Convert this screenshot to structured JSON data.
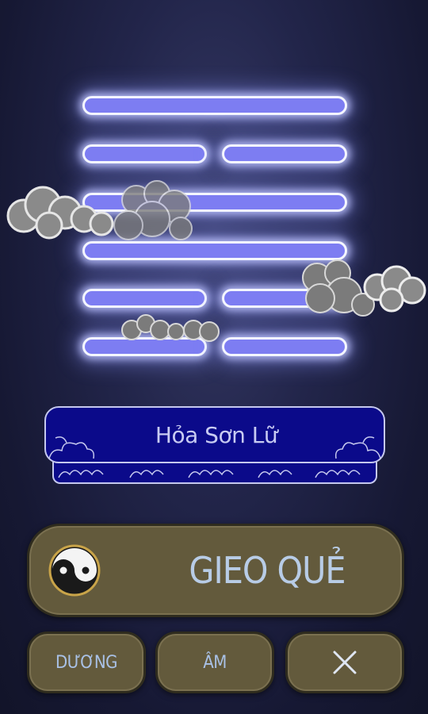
{
  "hexagram": {
    "name": "Hỏa Sơn Lữ",
    "lines": [
      "yang",
      "yin",
      "yang",
      "yang",
      "yin",
      "yin"
    ]
  },
  "buttons": {
    "cast_label": "GIEO QUẺ",
    "yang_label": "DƯƠNG",
    "yin_label": "ÂM",
    "clear_icon": "close-icon"
  },
  "colors": {
    "line_fill": "#7d7df2",
    "line_glow": "#bec3ff",
    "scroll_fill": "#0b0a8a",
    "button_fill": "#635a3c",
    "button_text": "#b8cce6"
  }
}
